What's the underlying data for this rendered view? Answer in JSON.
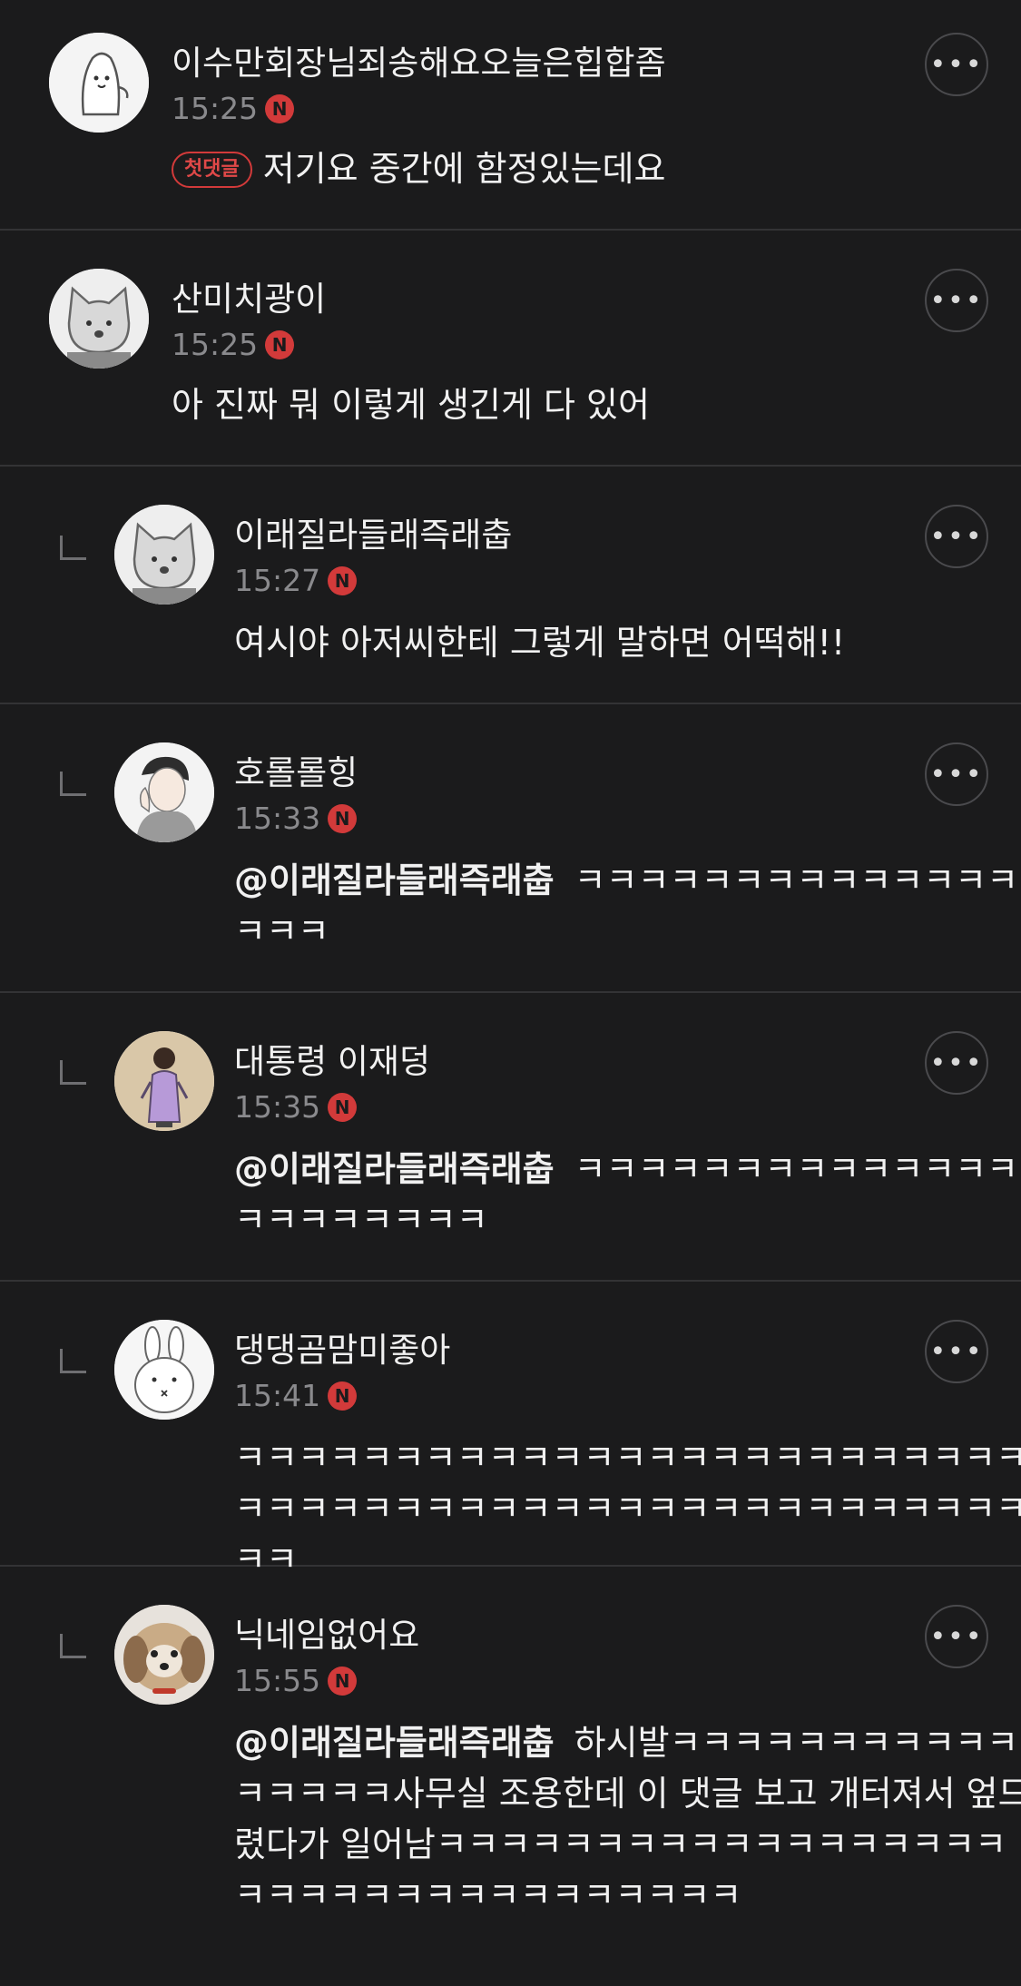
{
  "comments": [
    {
      "username": "이수만회장님죄송해요오늘은힙합좀",
      "time": "15:25",
      "badge": "N",
      "first_comment_label": "첫댓글",
      "text": "저기요 중간에 함정있는데요",
      "more": "•••"
    },
    {
      "username": "산미치광이",
      "time": "15:25",
      "badge": "N",
      "text": "아 진짜 뭐 이렇게 생긴게 다 있어",
      "more": "•••"
    },
    {
      "username": "이래질라들래즉래춥",
      "time": "15:27",
      "badge": "N",
      "text": "여시야 아저씨한테 그렇게 말하면 어떡해!!",
      "more": "•••"
    },
    {
      "username": "호롤롤힝",
      "time": "15:33",
      "badge": "N",
      "mention": "@이래질라들래즉래춥",
      "text": "ㅋㅋㅋㅋㅋㅋㅋㅋㅋㅋㅋㅋㅋㅋㅋㅋㅋ",
      "more": "•••"
    },
    {
      "username": "대통령 이재덩",
      "time": "15:35",
      "badge": "N",
      "mention": "@이래질라들래즉래춥",
      "text": "ㅋㅋㅋㅋㅋㅋㅋㅋㅋㅋㅋㅋㅋㅋㅋㅋㅋㅋㅋㅋㅋㅋ",
      "more": "•••"
    },
    {
      "username": "댕댕곰맘미좋아",
      "time": "15:41",
      "badge": "N",
      "text": "ㅋㅋㅋㅋㅋㅋㅋㅋㅋㅋㅋㅋㅋㅋㅋㅋㅋㅋㅋㅋㅋㅋㅋㅋㅋㅋㅋㅋㅋㅋㅋㅋㅋㅋㅋㅋㅋㅋㅋㅋㅋㅋㅋㅋㅋㅋㅋㅋㅋㅋㅋㅋ",
      "more": "•••"
    },
    {
      "username": "닉네임없어요",
      "time": "15:55",
      "badge": "N",
      "mention": "@이래질라들래즉래춥",
      "text": "하시발ㅋㅋㅋㅋㅋㅋㅋㅋㅋㅋㅋㅋㅋㅋㅋㅋ사무실 조용한데 이 댓글 보고 개터져서 엎드렸다가 일어남ㅋㅋㅋㅋㅋㅋㅋㅋㅋㅋㅋㅋㅋㅋㅋㅋㅋㅋㅋㅋㅋㅋㅋㅋㅋㅋㅋㅋㅋㅋㅋㅋㅋㅋ",
      "more": "•••"
    }
  ],
  "icons": {
    "reply_indicator": "reply-arrow-icon",
    "more": "more-options-icon",
    "naver_badge": "naver-n-badge"
  },
  "colors": {
    "background": "#1b1b1c",
    "divider": "#333335",
    "text": "#f1f1f1",
    "time": "#8a8a8d",
    "accent": "#d23a3a"
  }
}
